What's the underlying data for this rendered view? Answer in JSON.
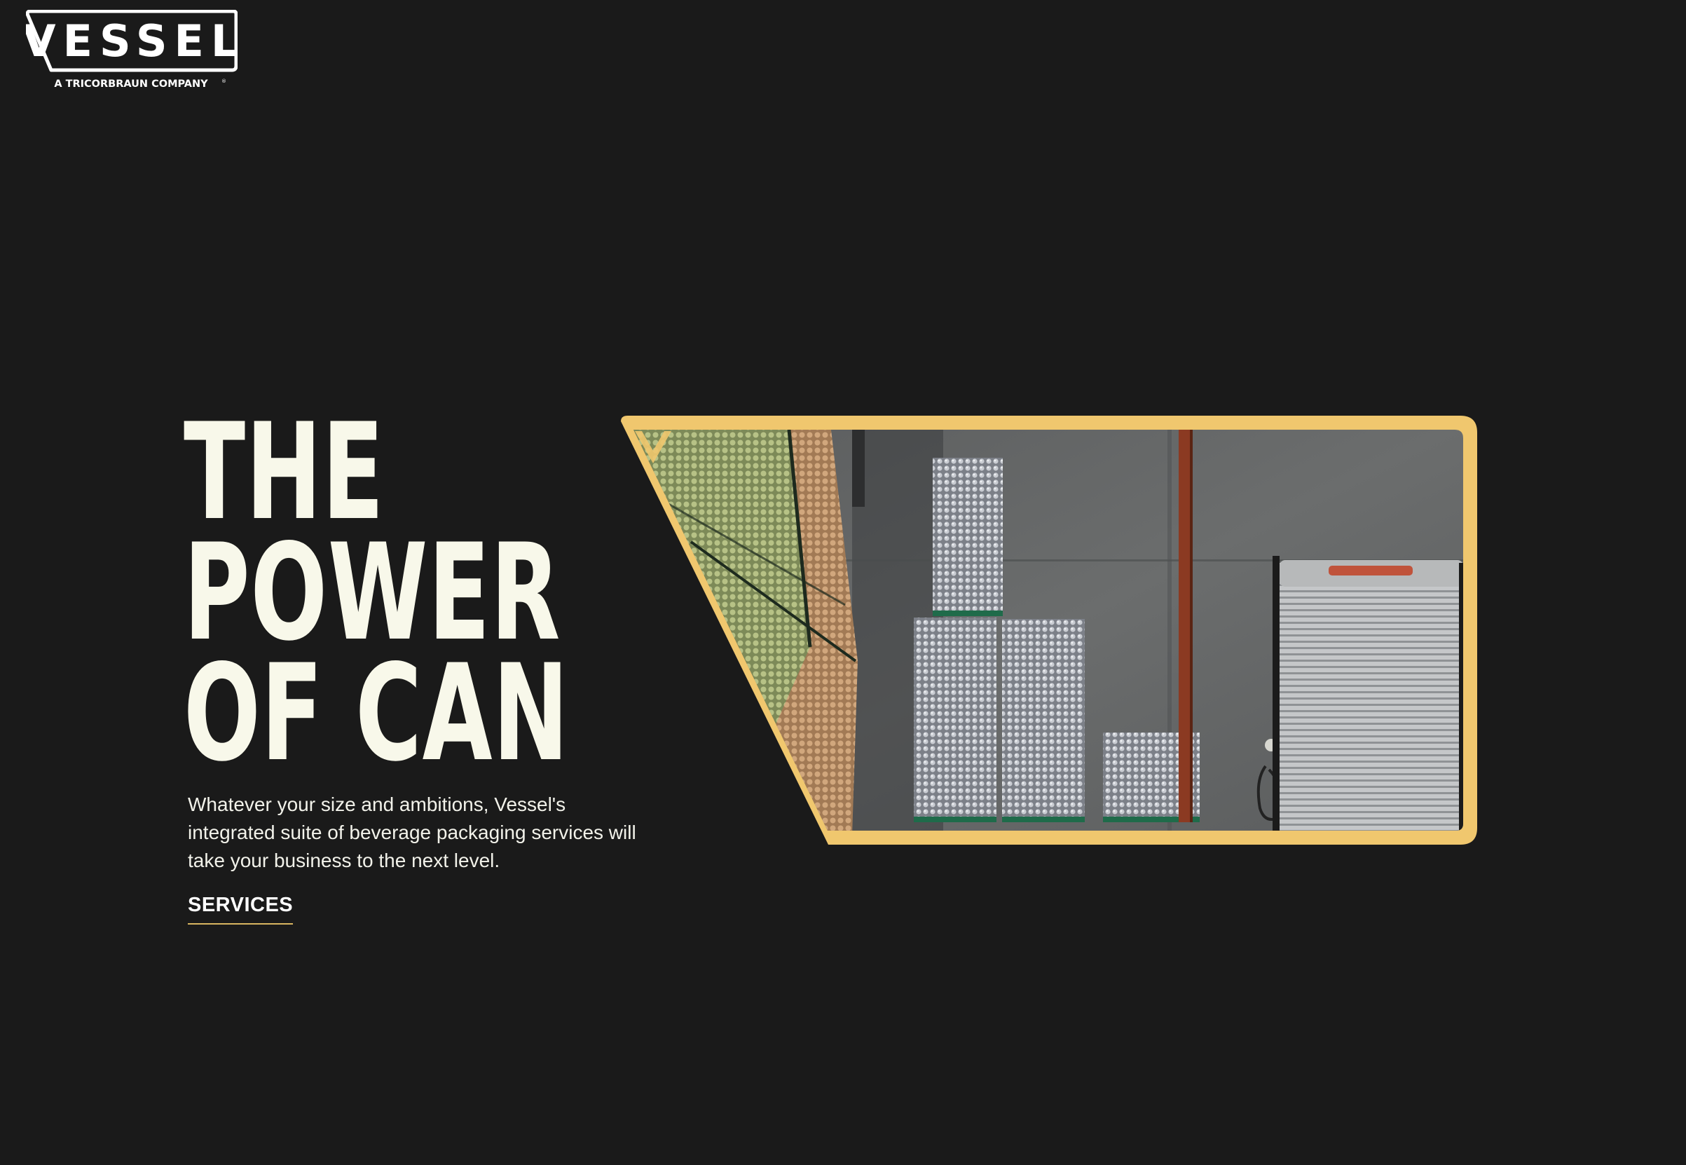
{
  "header": {
    "logo": {
      "wordmark": "VESSEL",
      "tagline": "A TRICORBRAUN COMPANY",
      "registered": "®"
    }
  },
  "hero": {
    "title_lines": [
      "THE",
      "POWER",
      "OF CAN"
    ],
    "description": "Whatever your size and ambitions, Vessel's integrated suite of beverage packaging services will take your business to the next level.",
    "cta_label": "SERVICES"
  },
  "colors": {
    "background": "#1a1a1a",
    "accent_gold": "#f0c76e",
    "text_cream": "#f8f8ea"
  }
}
